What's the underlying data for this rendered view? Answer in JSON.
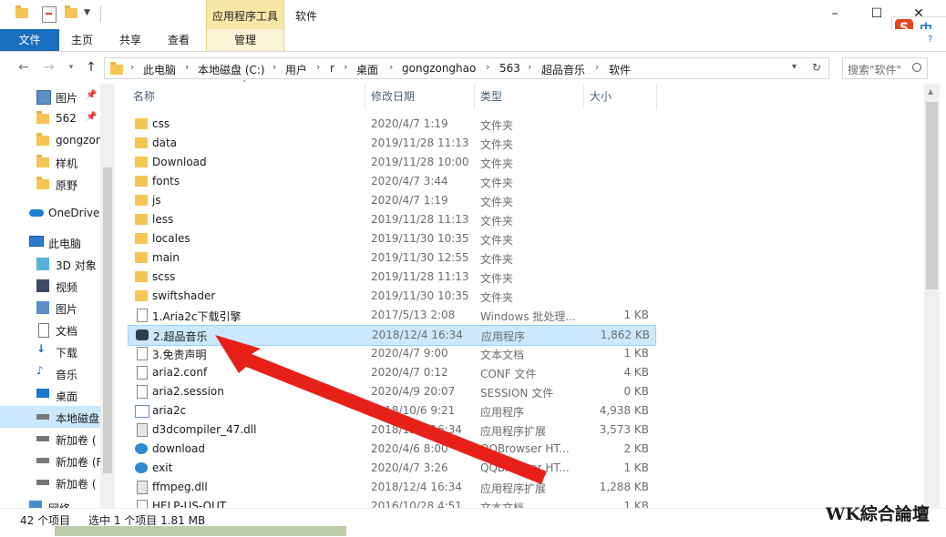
{
  "titlebar": {
    "context_tab": "应用程序工具",
    "title": "软件",
    "minimize": "–",
    "maximize": "☐",
    "close": "✕"
  },
  "ribbon": {
    "file": "文件",
    "home": "主页",
    "share": "共享",
    "view": "查看",
    "manage": "管理"
  },
  "address": {
    "crumbs": [
      "此电脑",
      "本地磁盘 (C:)",
      "用户",
      "r",
      "桌面",
      "gongzonghao",
      "563",
      "超品音乐",
      "软件"
    ],
    "search_placeholder": "搜索\"软件\""
  },
  "nav": {
    "quick": [
      {
        "label": "图片",
        "pinned": true
      },
      {
        "label": "562",
        "pinned": true
      },
      {
        "label": "gongzon",
        "pinned": false
      },
      {
        "label": "样机",
        "pinned": false
      },
      {
        "label": "原野",
        "pinned": false
      }
    ],
    "onedrive": "OneDrive",
    "thispc": "此电脑",
    "pc_items": [
      "3D 对象",
      "视频",
      "图片",
      "文档",
      "下载",
      "音乐",
      "桌面",
      "本地磁盘",
      "新加卷 (",
      "新加卷 (F",
      "新加卷 (",
      "网络"
    ]
  },
  "columns": {
    "name": "名称",
    "date": "修改日期",
    "type": "类型",
    "size": "大小"
  },
  "files": [
    {
      "name": "css",
      "date": "2020/4/7 1:19",
      "type": "文件夹",
      "size": "",
      "icon": "folder"
    },
    {
      "name": "data",
      "date": "2019/11/28 11:13",
      "type": "文件夹",
      "size": "",
      "icon": "folder"
    },
    {
      "name": "Download",
      "date": "2019/11/28 10:00",
      "type": "文件夹",
      "size": "",
      "icon": "folder"
    },
    {
      "name": "fonts",
      "date": "2020/4/7 3:44",
      "type": "文件夹",
      "size": "",
      "icon": "folder"
    },
    {
      "name": "js",
      "date": "2020/4/7 1:19",
      "type": "文件夹",
      "size": "",
      "icon": "folder"
    },
    {
      "name": "less",
      "date": "2019/11/28 11:13",
      "type": "文件夹",
      "size": "",
      "icon": "folder"
    },
    {
      "name": "locales",
      "date": "2019/11/30 10:35",
      "type": "文件夹",
      "size": "",
      "icon": "folder"
    },
    {
      "name": "main",
      "date": "2019/11/30 12:55",
      "type": "文件夹",
      "size": "",
      "icon": "folder"
    },
    {
      "name": "scss",
      "date": "2019/11/28 11:13",
      "type": "文件夹",
      "size": "",
      "icon": "folder"
    },
    {
      "name": "swiftshader",
      "date": "2019/11/30 10:35",
      "type": "文件夹",
      "size": "",
      "icon": "folder"
    },
    {
      "name": "1.Aria2c下载引擎",
      "date": "2017/5/13 2:08",
      "type": "Windows 批处理...",
      "size": "1 KB",
      "icon": "doc"
    },
    {
      "name": "2.超品音乐",
      "date": "2018/12/4 16:34",
      "type": "应用程序",
      "size": "1,862 KB",
      "icon": "app"
    },
    {
      "name": "3.免责声明",
      "date": "2020/4/7 9:00",
      "type": "文本文档",
      "size": "1 KB",
      "icon": "doc"
    },
    {
      "name": "aria2.conf",
      "date": "2020/4/7 0:12",
      "type": "CONF 文件",
      "size": "4 KB",
      "icon": "doc"
    },
    {
      "name": "aria2.session",
      "date": "2020/4/9 20:07",
      "type": "SESSION 文件",
      "size": "0 KB",
      "icon": "doc"
    },
    {
      "name": "aria2c",
      "date": "2018/10/6 9:21",
      "type": "应用程序",
      "size": "4,938 KB",
      "icon": "exe"
    },
    {
      "name": "d3dcompiler_47.dll",
      "date": "2018/12/4 16:34",
      "type": "应用程序扩展",
      "size": "3,573 KB",
      "icon": "dll"
    },
    {
      "name": "download",
      "date": "2020/4/6 8:00",
      "type": "QQBrowser HT...",
      "size": "2 KB",
      "icon": "web"
    },
    {
      "name": "exit",
      "date": "2020/4/7 3:26",
      "type": "QQBrowser HT...",
      "size": "1 KB",
      "icon": "web"
    },
    {
      "name": "ffmpeg.dll",
      "date": "2018/12/4 16:34",
      "type": "应用程序扩展",
      "size": "1,288 KB",
      "icon": "dll"
    },
    {
      "name": "HELP-US-OUT",
      "date": "2016/10/28 4:51",
      "type": "文本文档",
      "size": "1 KB",
      "icon": "doc"
    }
  ],
  "status": {
    "count": "42 个项目",
    "selected": "选中 1 个项目  1.81 MB"
  },
  "ime": {
    "logo": "S",
    "lang": "中"
  },
  "watermark": "WK綜合論壇",
  "colors": {
    "file_tab": "#1a6fc0",
    "context_tab": "#f8e7a6",
    "selection": "#cce8ff",
    "arrow": "#e8201a"
  }
}
